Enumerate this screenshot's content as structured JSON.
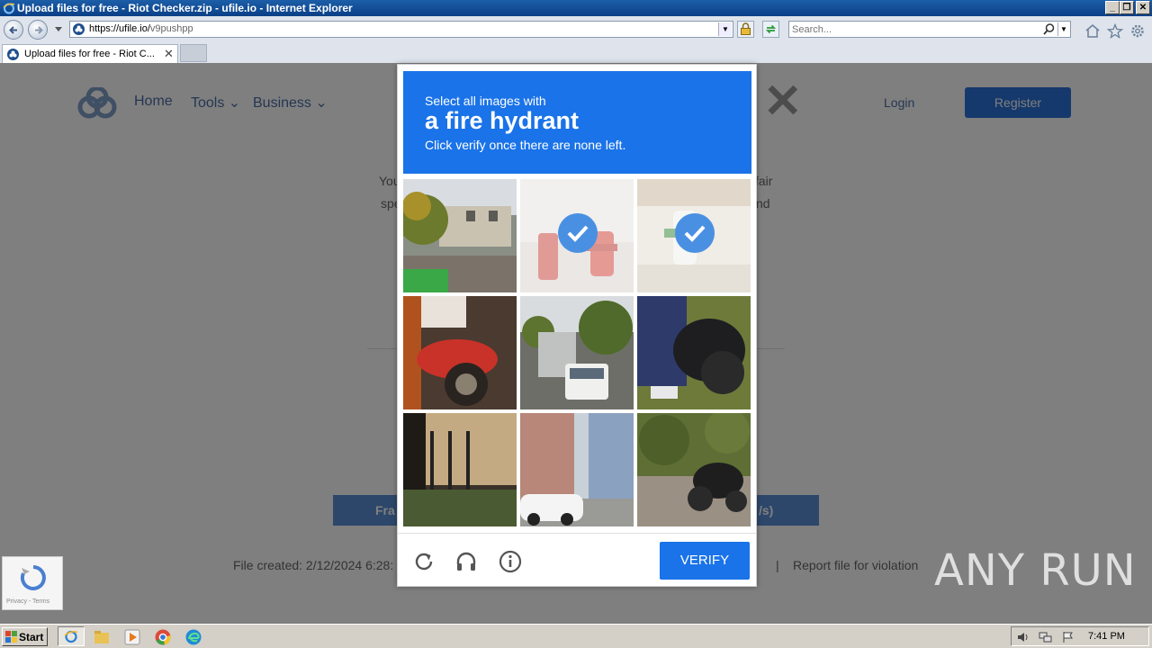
{
  "window": {
    "title": "Upload files for free - Riot Checker.zip - ufile.io - Internet Explorer",
    "minimize_glyph": "_",
    "restore_glyph": "❐",
    "close_glyph": "✕"
  },
  "address_bar": {
    "url_host": "https://ufile.io/",
    "url_path": "v9pushpp",
    "search_placeholder": "Search..."
  },
  "tab": {
    "title": "Upload files for free - Riot C...",
    "close_glyph": "✕"
  },
  "page": {
    "nav": {
      "home": "Home",
      "tools": "Tools ⌄",
      "business": "Business ⌄",
      "login": "Login",
      "register": "Register"
    },
    "panel": {
      "close_glyph": "✕",
      "frag_you": "You",
      "frag_spe": "spe",
      "frag_fair": "fair",
      "frag_nd": "nd"
    },
    "button_left_fragment": "Fra",
    "button_right_fragment": "/s)",
    "footer_created": "File created: 2/12/2024 6:28:",
    "footer_separator": "|",
    "footer_report": "Report file for violation",
    "recaptcha_badge_text": "Privacy - Terms",
    "watermark": "ANY RUN"
  },
  "captcha": {
    "instruction_line1": "Select all images with",
    "target_object": "a fire hydrant",
    "instruction_line3": "Click verify once there are none left.",
    "tiles": [
      {
        "name": "street-houses",
        "selected": false
      },
      {
        "name": "red-fire-hydrant",
        "selected": true
      },
      {
        "name": "white-fire-hydrant",
        "selected": true
      },
      {
        "name": "red-motorcycle",
        "selected": false
      },
      {
        "name": "road-truck",
        "selected": false
      },
      {
        "name": "scooter-rider",
        "selected": false
      },
      {
        "name": "building-stairs",
        "selected": false
      },
      {
        "name": "pole-car",
        "selected": false
      },
      {
        "name": "scooter-hedge",
        "selected": false
      }
    ],
    "verify_label": "VERIFY",
    "colors": {
      "accent": "#1a73e8",
      "check": "#4a90e2"
    }
  },
  "taskbar": {
    "start_label": "Start",
    "clock": "7:41 PM"
  }
}
